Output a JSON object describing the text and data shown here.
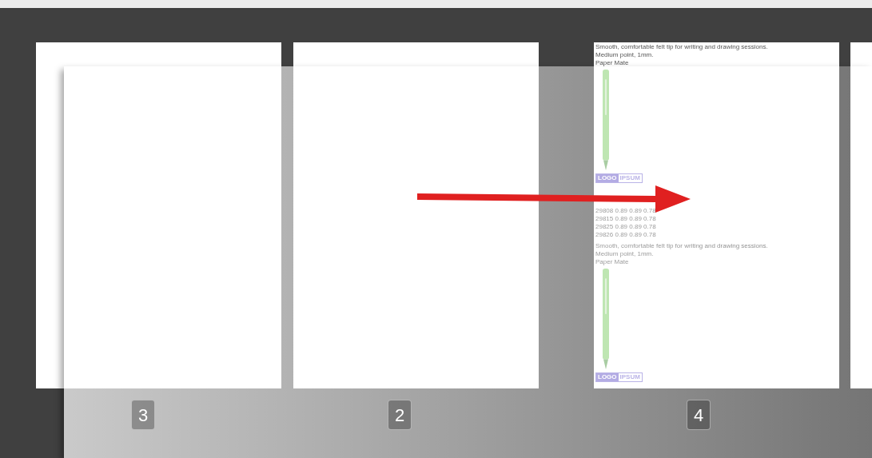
{
  "pages": [
    {
      "number": "3",
      "kind": "blank"
    },
    {
      "number": "2",
      "kind": "blank"
    },
    {
      "number": "4",
      "kind": "catalog",
      "sections": [
        {
          "description": "Smooth, comfortable felt tip for writing and drawing sessions.",
          "detail": "Medium point, 1mm.",
          "brand": "Paper Mate",
          "logo": [
            "LOGO",
            "IPSUM"
          ],
          "rows": [
            [
              "29808",
              "0.89",
              "0.89",
              "0.78"
            ],
            [
              "29815",
              "0.89",
              "0.89",
              "0.78"
            ],
            [
              "29825",
              "0.89",
              "0.89",
              "0.78"
            ],
            [
              "29826",
              "0.89",
              "0.89",
              "0.78"
            ]
          ]
        },
        {
          "description": "Smooth, comfortable felt tip for writing and drawing sessions.",
          "detail": "Medium point, 1mm.",
          "brand": "Paper Mate",
          "logo": [
            "LOGO",
            "IPSUM"
          ]
        }
      ]
    },
    {
      "kind": "blank"
    }
  ]
}
